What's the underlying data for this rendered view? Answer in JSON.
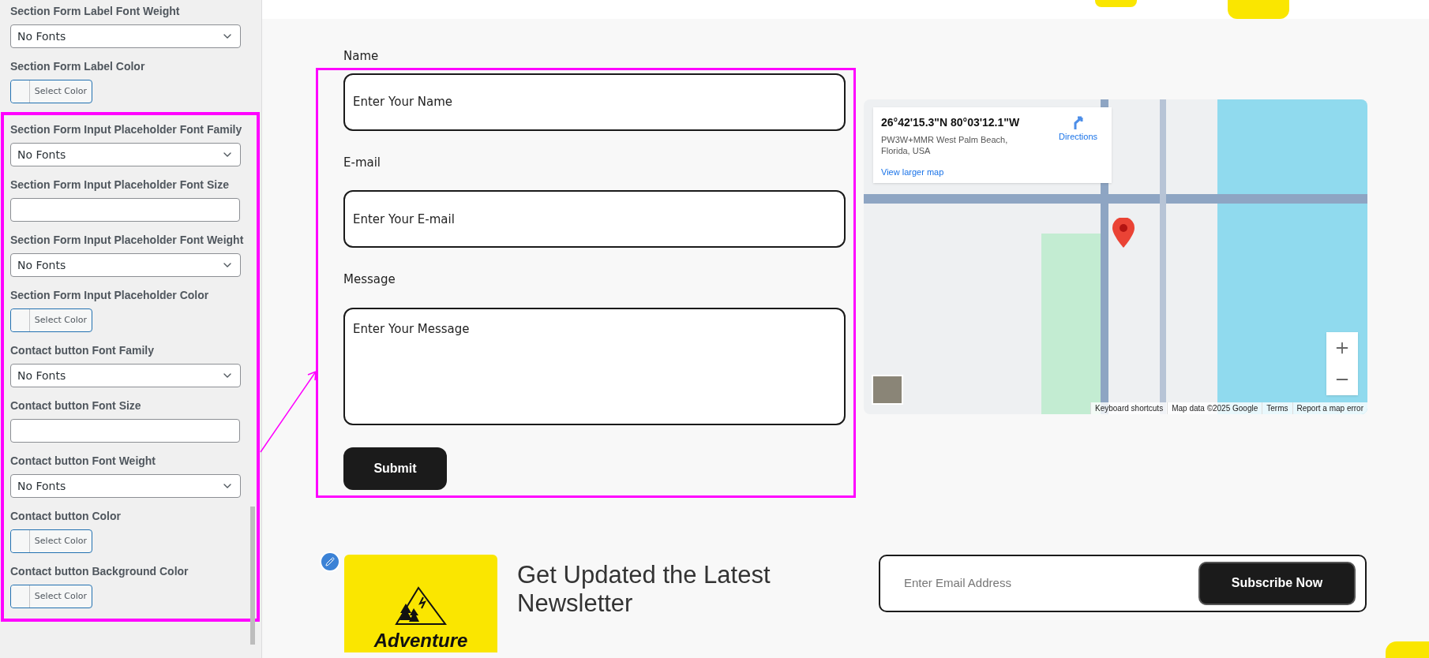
{
  "sidebar": {
    "sections": [
      {
        "highlighted": false,
        "items": [
          {
            "kind": "select",
            "label": "Section Form Label Font Weight",
            "value": "No Fonts"
          },
          {
            "kind": "color",
            "label": "Section Form Label Color",
            "button": "Select Color"
          }
        ]
      },
      {
        "highlighted": true,
        "items": [
          {
            "kind": "select",
            "label": "Section Form Input Placeholder Font Family",
            "value": "No Fonts"
          },
          {
            "kind": "text",
            "label": "Section Form Input Placeholder Font Size"
          },
          {
            "kind": "select",
            "label": "Section Form Input Placeholder Font Weight",
            "value": "No Fonts"
          },
          {
            "kind": "color",
            "label": "Section Form Input Placeholder Color",
            "button": "Select Color"
          },
          {
            "kind": "select",
            "label": "Contact button Font Family",
            "value": "No Fonts"
          },
          {
            "kind": "text",
            "label": "Contact button Font Size"
          },
          {
            "kind": "select",
            "label": "Contact button Font Weight",
            "value": "No Fonts"
          },
          {
            "kind": "color",
            "label": "Contact button Color",
            "button": "Select Color"
          },
          {
            "kind": "color",
            "label": "Contact button Background Color",
            "button": "Select Color"
          }
        ]
      }
    ]
  },
  "form": {
    "highlighted": true,
    "fields": [
      {
        "kind": "input",
        "label": "Name",
        "placeholder": "Enter Your Name"
      },
      {
        "kind": "input",
        "label": "E-mail",
        "placeholder": "Enter Your E-mail"
      },
      {
        "kind": "textarea",
        "label": "Message",
        "placeholder": "Enter Your Message"
      }
    ],
    "submit": "Submit"
  },
  "map": {
    "coordinates": "26°42'15.3\"N 80°03'12.1\"W",
    "address": "PW3W+MMR West Palm Beach, Florida, USA",
    "directions": "Directions",
    "larger_map": "View larger map",
    "footer": [
      "Keyboard shortcuts",
      "Map data ©2025 Google",
      "Terms",
      "Report a map error"
    ]
  },
  "newsletter": {
    "brand": "Adventure",
    "title": "Get Updated the Latest Newsletter",
    "email_placeholder": "Enter Email Address",
    "button": "Subscribe Now"
  }
}
